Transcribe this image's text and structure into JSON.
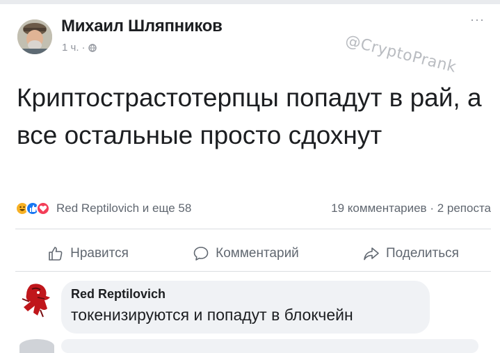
{
  "post": {
    "author": "Михаил Шляпников",
    "time": "1 ч.",
    "meta_separator": "·",
    "more_label": "···",
    "watermark": "@CryptoPrank",
    "text": "Криптострастотерпцы попадут в рай, а все остальные просто сдохнут",
    "reactions_text": "Red Reptilovich и еще 58",
    "stats_text": "19 комментариев · 2 репоста"
  },
  "actions": {
    "like_label": "Нравится",
    "comment_label": "Комментарий",
    "share_label": "Поделиться"
  },
  "comment": {
    "author": "Red Reptilovich",
    "text": "токенизируются и попадут в блокчейн"
  },
  "icons": {
    "reactions": [
      "haha-reaction-icon",
      "like-reaction-icon",
      "love-reaction-icon"
    ],
    "privacy": "globe-icon",
    "like": "thumbs-up-icon",
    "comment": "speech-bubble-icon",
    "share": "share-arrow-icon"
  },
  "colors": {
    "text": "#1c1e21",
    "secondary_text": "#606770",
    "meta_text": "#90949c",
    "bubble": "#f0f2f5",
    "divider": "#dadde1",
    "like_blue": "#1877f2",
    "love_red": "#f33e58",
    "haha_yellow": "#f7b125"
  }
}
